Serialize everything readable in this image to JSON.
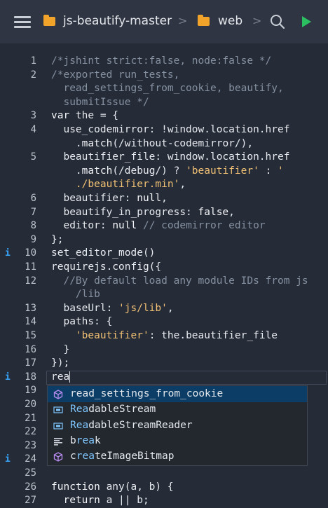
{
  "toolbar": {
    "crumbs": [
      "js-beautify-master",
      "web"
    ],
    "separator": ">"
  },
  "editor": {
    "lines": [
      {
        "n": "1",
        "t": [
          [
            "c",
            "/*jshint strict:false, node:false */"
          ]
        ]
      },
      {
        "n": "2",
        "t": [
          [
            "c",
            "/*exported run_tests,"
          ]
        ]
      },
      {
        "n": "",
        "t": [
          [
            "c",
            "  read_settings_from_cookie, beautify,"
          ]
        ]
      },
      {
        "n": "",
        "t": [
          [
            "c",
            "  submitIssue */"
          ]
        ]
      },
      {
        "n": "3",
        "t": [
          [
            "k",
            "var "
          ],
          [
            "",
            "the = {"
          ]
        ]
      },
      {
        "n": "4",
        "t": [
          [
            "",
            "  use_codemirror: !window.location.href"
          ]
        ]
      },
      {
        "n": "",
        "t": [
          [
            "",
            "    ."
          ],
          [
            "f",
            "match"
          ],
          [
            "",
            "(/without-codemirror/),"
          ]
        ]
      },
      {
        "n": "5",
        "t": [
          [
            "",
            "  beautifier_file: window.location.href"
          ]
        ]
      },
      {
        "n": "",
        "t": [
          [
            "",
            "    ."
          ],
          [
            "f",
            "match"
          ],
          [
            "",
            "(/debug/) ? "
          ],
          [
            "s",
            "'beautifier'"
          ],
          [
            "",
            " : "
          ],
          [
            "s",
            "'"
          ]
        ]
      },
      {
        "n": "",
        "t": [
          [
            "s",
            "    ./beautifier.min'"
          ],
          [
            "",
            ","
          ]
        ]
      },
      {
        "n": "6",
        "t": [
          [
            "",
            "  beautifier: "
          ],
          [
            "k",
            "null"
          ],
          [
            "",
            ","
          ]
        ]
      },
      {
        "n": "7",
        "t": [
          [
            "",
            "  beautify_in_progress: "
          ],
          [
            "k",
            "false"
          ],
          [
            "",
            ","
          ]
        ]
      },
      {
        "n": "8",
        "t": [
          [
            "",
            "  editor: "
          ],
          [
            "k",
            "null"
          ],
          [
            "",
            " "
          ],
          [
            "c",
            "// codemirror editor"
          ]
        ]
      },
      {
        "n": "9",
        "t": [
          [
            "",
            "};"
          ]
        ]
      },
      {
        "n": "10",
        "i": true,
        "t": [
          [
            "",
            "set_editor_mode()"
          ]
        ]
      },
      {
        "n": "11",
        "t": [
          [
            "",
            "requirejs.config({"
          ]
        ]
      },
      {
        "n": "12",
        "t": [
          [
            "c",
            "  //By default load any module IDs from js"
          ]
        ]
      },
      {
        "n": "",
        "t": [
          [
            "c",
            "    /lib"
          ]
        ]
      },
      {
        "n": "13",
        "t": [
          [
            "",
            "  baseUrl: "
          ],
          [
            "s",
            "'js/lib'"
          ],
          [
            "",
            ","
          ]
        ]
      },
      {
        "n": "14",
        "t": [
          [
            "",
            "  paths: {"
          ]
        ]
      },
      {
        "n": "15",
        "t": [
          [
            "s",
            "    'beautifier'"
          ],
          [
            "",
            ": the.beautifier_file"
          ]
        ]
      },
      {
        "n": "16",
        "t": [
          [
            "",
            "  }"
          ]
        ]
      },
      {
        "n": "17",
        "t": [
          [
            "",
            "});"
          ]
        ]
      },
      {
        "n": "18",
        "i": true,
        "cur": true,
        "t": [
          [
            "",
            "rea"
          ]
        ]
      },
      {
        "n": "19",
        "t": []
      },
      {
        "n": "20",
        "t": []
      },
      {
        "n": "21",
        "t": []
      },
      {
        "n": "22",
        "t": []
      },
      {
        "n": "23",
        "t": []
      },
      {
        "n": "24",
        "i": true,
        "t": []
      },
      {
        "n": "25",
        "t": []
      },
      {
        "n": "26",
        "t": [
          [
            "k",
            "function "
          ],
          [
            "",
            "any(a, b) {"
          ]
        ]
      },
      {
        "n": "27",
        "t": [
          [
            "k",
            "  return "
          ],
          [
            "",
            "a || b;"
          ]
        ]
      }
    ]
  },
  "autocomplete": {
    "typed": "rea",
    "items": [
      {
        "label": "read_settings_from_cookie",
        "match": "",
        "icon": "cube-icon",
        "selected": true
      },
      {
        "label": "ReadableStream",
        "match": "Rea",
        "icon": "variable-icon"
      },
      {
        "label": "ReadableStreamReader",
        "match": "Rea",
        "icon": "variable-icon"
      },
      {
        "label": "break",
        "match": "b_re_a",
        "icon": "snippet-icon"
      },
      {
        "label": "createImageBitmap",
        "match": "c_re_a",
        "icon": "cube-icon"
      }
    ]
  }
}
